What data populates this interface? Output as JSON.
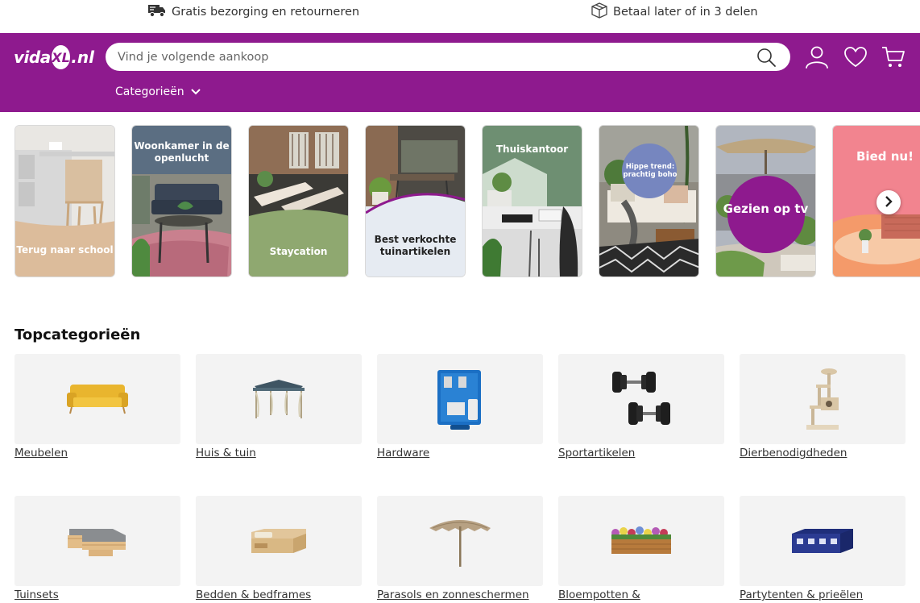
{
  "infobar": {
    "delivery_text": "Gratis bezorging en retourneren",
    "payment_text": "Betaal later of in 3 delen"
  },
  "header": {
    "logo_text_a": "vida",
    "logo_text_xl": "XL",
    "logo_text_nl": ".nl",
    "search_placeholder": "Vind je volgende aankoop",
    "categories_label": "Categorieën"
  },
  "banners": [
    {
      "label": "Terug naar school"
    },
    {
      "label": "Woonkamer in de openlucht"
    },
    {
      "label": "Staycation"
    },
    {
      "label": "Best verkochte tuinartikelen"
    },
    {
      "label": "Thuiskantoor"
    },
    {
      "label": "Hippe trend: prachtig boho"
    },
    {
      "label": "Gezien op tv"
    },
    {
      "label": "Bied nu!"
    }
  ],
  "top_categories": {
    "title": "Topcategorieën",
    "items": [
      {
        "label": "Meubelen"
      },
      {
        "label": "Huis & tuin"
      },
      {
        "label": "Hardware"
      },
      {
        "label": "Sportartikelen"
      },
      {
        "label": "Dierbenodigdheden"
      },
      {
        "label": "Tuinsets"
      },
      {
        "label": "Bedden & bedframes"
      },
      {
        "label": "Parasols en zonneschermen"
      },
      {
        "label": "Bloempotten &"
      },
      {
        "label": "Partytenten & prieëlen"
      }
    ]
  },
  "colors": {
    "brand_purple": "#8e1a8e",
    "text": "#222222",
    "tile_bg": "#f3f3f3"
  }
}
